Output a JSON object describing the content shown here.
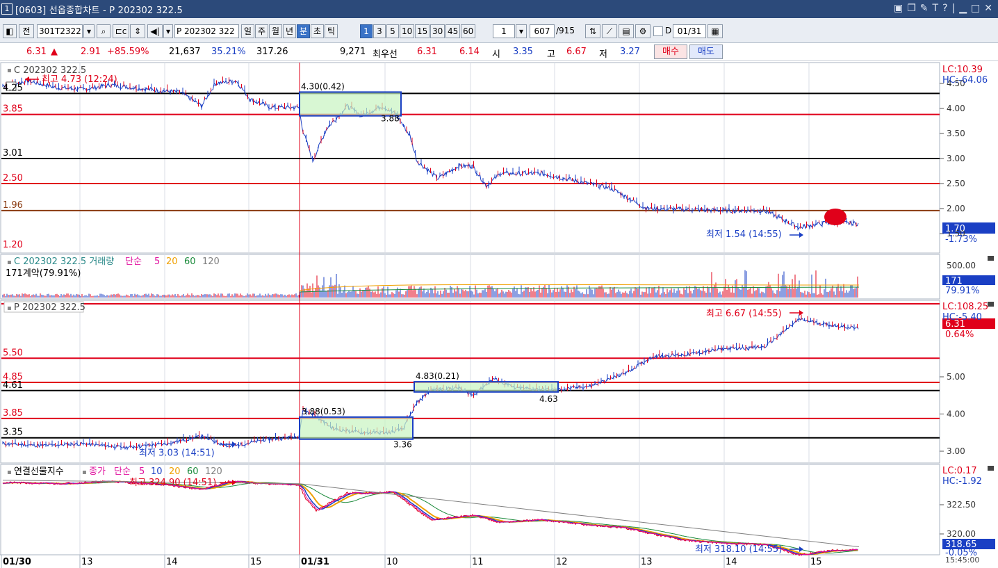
{
  "window": {
    "number": "1",
    "title": "[0603] 선옵종합차트 - P 202302 322.5",
    "icons": [
      "layout-icon",
      "restore-window-icon",
      "tool-icon",
      "text-icon",
      "help-icon",
      "minimize-icon",
      "maximize-icon",
      "close-icon"
    ]
  },
  "toolbar": {
    "all_label": "전",
    "code": "301T2322",
    "symbol": "P 202302 322",
    "period_tabs": [
      "일",
      "주",
      "월",
      "년",
      "분",
      "초",
      "틱"
    ],
    "active_period": "분",
    "intervals": [
      "1",
      "3",
      "5",
      "10",
      "15",
      "30",
      "45",
      "60"
    ],
    "active_interval": "1",
    "count": "1",
    "range": "607",
    "range_total": "/915",
    "date_toggle": "D",
    "date": "01/31"
  },
  "quote": {
    "price": "6.31",
    "direction": "▲",
    "change": "2.91",
    "change_pct": "+85.59%",
    "volume": "21,637",
    "volume_pct": "35.21%",
    "amount": "317.26",
    "open_interest": "9,271",
    "best_bid_label": "최우선",
    "best_bid1": "6.31",
    "best_bid2": "6.14",
    "open_label": "시",
    "open": "3.35",
    "high_label": "고",
    "high": "6.67",
    "low_label": "저",
    "low": "3.27",
    "buy_label": "매수",
    "sell_label": "매도"
  },
  "panel1": {
    "title": "C 202302 322.5",
    "max_note": "최고 4.73 (12:24)",
    "min_note": "최저 1.54 (14:55)",
    "box_label": "4.30(0.42)",
    "box_low_label": "3.88",
    "lc": "LC:10.39",
    "hc": "HC:-64.06",
    "last_price": "1.70",
    "last_pct": "-1.73%",
    "levels": [
      {
        "label": "4.25",
        "value": 4.3,
        "color": "#000000"
      },
      {
        "label": "3.85",
        "value": 3.88,
        "color": "#e0001a"
      },
      {
        "label": "3.01",
        "value": 3.0,
        "color": "#000000"
      },
      {
        "label": "2.50",
        "value": 2.5,
        "color": "#e0001a"
      },
      {
        "label": "1.96",
        "value": 1.96,
        "color": "#8a3a10"
      }
    ],
    "bottom_label": "1.20",
    "axis_ticks": [
      "4.50",
      "4.00",
      "3.50",
      "3.00",
      "2.50",
      "2.00",
      "1.50"
    ]
  },
  "panel2": {
    "title": "C 202302 322.5 거래량",
    "ma_type": "단순",
    "ma": [
      "5",
      "20",
      "60",
      "120"
    ],
    "contracts": "171계약(79.91%)",
    "axis_ticks": [
      "500.00"
    ],
    "last": "171",
    "last_pct": "79.91%"
  },
  "panel3": {
    "title": "P 202302 322.5",
    "max_note": "최고 6.67 (14:55)",
    "min_note": "최저 3.03 (14:51)",
    "box1_label": "3.88(0.53)",
    "box1_low_label": "3.36",
    "box2_label": "4.83(0.21)",
    "box2_low_label": "4.63",
    "lc": "LC:108.25",
    "hc": "HC:-5.40",
    "last_price": "6.31",
    "last_pct": "0.64%",
    "levels": [
      {
        "label": "5.50",
        "value": 5.5,
        "color": "#e0001a"
      },
      {
        "label": "4.85",
        "value": 4.85,
        "color": "#e0001a"
      },
      {
        "label": "4.61",
        "value": 4.63,
        "color": "#000000"
      },
      {
        "label": "3.85",
        "value": 3.88,
        "color": "#e0001a"
      },
      {
        "label": "3.35",
        "value": 3.36,
        "color": "#000000"
      }
    ],
    "axis_ticks": [
      "5.00",
      "4.00",
      "3.00"
    ]
  },
  "panel4": {
    "title": "연결선물지수",
    "price_label": "종가",
    "ma_type": "단순",
    "ma": [
      "5",
      "10",
      "20",
      "60",
      "120"
    ],
    "max_note": "최고 324.90 (14:51)",
    "min_note": "최저 318.10 (14:55)",
    "lc": "LC:0.17",
    "hc": "HC:-1.92",
    "last_price": "318.65",
    "last_pct": "-0.05%",
    "axis_ticks": [
      "322.50",
      "320.00"
    ],
    "time_label": "15:45:00"
  },
  "xaxis": [
    "01/30",
    "13",
    "14",
    "15",
    "01/31",
    "10",
    "11",
    "12",
    "13",
    "14",
    "15"
  ],
  "colors": {
    "up": "#e0001a",
    "down": "#1a3fc4",
    "box_fill": "#c8f3c0",
    "box_border": "#1a3fc4",
    "ma5": "#e0109e",
    "ma10": "#1a3fc4",
    "ma20": "#f0a000",
    "ma60": "#1a8a3a",
    "ma120": "#808080"
  }
}
